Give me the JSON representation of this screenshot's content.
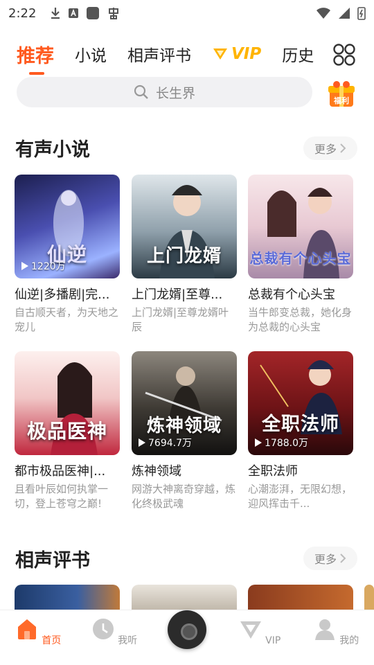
{
  "status": {
    "time": "2:22"
  },
  "tabs": [
    {
      "label": "推荐"
    },
    {
      "label": "小说"
    },
    {
      "label": "相声评书"
    },
    {
      "label": "VIP"
    },
    {
      "label": "历史"
    }
  ],
  "search": {
    "placeholder": "长生界"
  },
  "gift": {
    "label": "福利"
  },
  "sections": {
    "novels": {
      "title": "有声小说",
      "more": "更多"
    },
    "crosstalk": {
      "title": "相声评书",
      "more": "更多"
    }
  },
  "novels": [
    {
      "title": "仙逆|多播剧|完...",
      "desc": "自古顺天者，为天地之宠儿",
      "plays": "1220万",
      "cover_text": "仙逆",
      "color_top": "#3b3f8f",
      "color_bottom": "#8aa8ff"
    },
    {
      "title": "上门龙婿|至尊...",
      "desc": "上门龙婿|至尊龙婿叶辰",
      "plays": "",
      "cover_text": "上门龙婿",
      "color_top": "#c9d3dc",
      "color_bottom": "#3a4a55"
    },
    {
      "title": "总裁有个心头宝",
      "desc": "当牛郎变总裁，她化身为总裁的心头宝",
      "plays": "",
      "cover_text": "总裁有个心头宝",
      "color_top": "#f3dede",
      "color_bottom": "#b78fae"
    },
    {
      "title": "都市极品医神|...",
      "desc": "且看叶辰如何执掌一切，登上苍穹之巅!",
      "plays": "",
      "cover_text": "极品医神",
      "color_top": "#fbe4e4",
      "color_bottom": "#b3243a"
    },
    {
      "title": "炼神领域",
      "desc": "网游大神离奇穿越，炼化终极武魂",
      "plays": "7694.7万",
      "cover_text": "炼神领域",
      "color_top": "#6f6a62",
      "color_bottom": "#1e1b18"
    },
    {
      "title": "全职法师",
      "desc": "心潮澎湃，无限幻想，迎风挥击千...",
      "plays": "1788.0万",
      "cover_text": "全职法师",
      "color_top": "#8c1f22",
      "color_bottom": "#3b0d10"
    }
  ],
  "nav": [
    {
      "label": "首页"
    },
    {
      "label": "我听"
    },
    {
      "label": "VIP"
    },
    {
      "label": "我的"
    }
  ],
  "colors": {
    "accent": "#ff5a1f",
    "vip": "#ffb400"
  }
}
